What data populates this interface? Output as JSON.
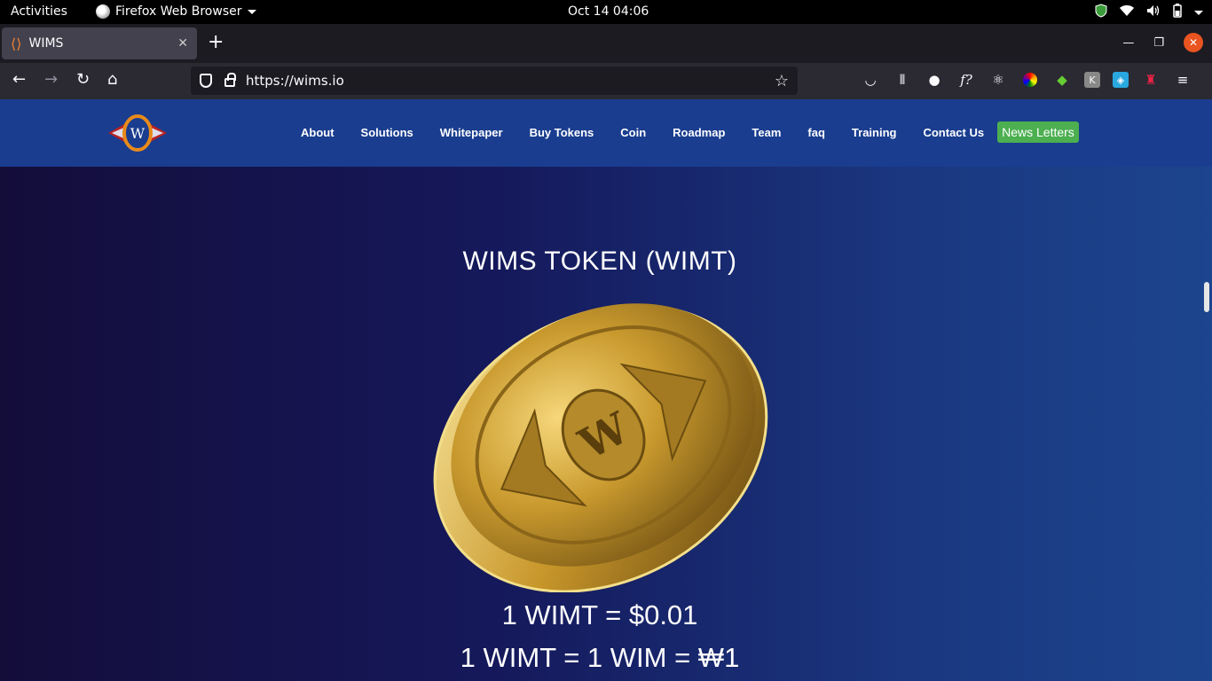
{
  "system": {
    "activities": "Activities",
    "app_name": "Firefox Web Browser",
    "clock": "Oct 14  04:06"
  },
  "browser": {
    "tab_title": "WIMS",
    "new_tab": "+",
    "url": "https://wims.io"
  },
  "site": {
    "nav": [
      "About",
      "Solutions",
      "Whitepaper",
      "Buy Tokens",
      "Coin",
      "Roadmap",
      "Team",
      "faq",
      "Training",
      "Contact Us"
    ],
    "news_button": "News Letters",
    "hero_title": "WIMS TOKEN (WIMT)",
    "rate_usd": "1 WIMT = $0.01",
    "rate_wim": "1 WIMT = 1 WIM = ₩1",
    "coin_letter": "W",
    "logo_letter": "W"
  },
  "colors": {
    "header_bg": "#1a3d8f",
    "news_button_bg": "#4caf50",
    "coin_gold": "#c9a130"
  }
}
